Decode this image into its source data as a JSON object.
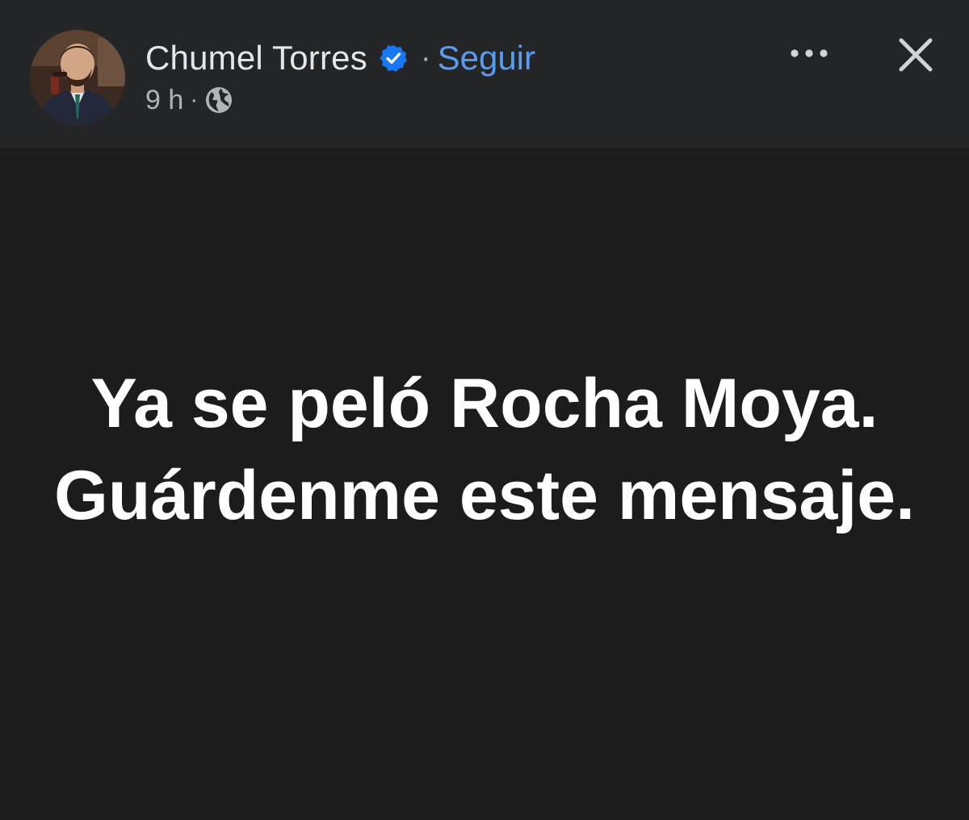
{
  "post": {
    "author": {
      "name": "Chumel Torres",
      "verified_icon": "verified-badge-icon",
      "avatar_icon": "avatar-photo"
    },
    "separator": "·",
    "follow_label": "Seguir",
    "timestamp": "9 h",
    "meta_separator": "·",
    "audience_icon": "globe-icon",
    "actions": {
      "more_icon": "more-options-icon",
      "close_icon": "close-icon"
    },
    "text": "Ya se peló Rocha Moya. Guárdenme este mensaje."
  },
  "colors": {
    "header_bg": "#242526",
    "body_bg": "#1c1c1c",
    "primary_text": "#e4e6eb",
    "secondary_text": "#b0b3b8",
    "link": "#5a9bf0",
    "verified": "#1877f2",
    "post_text": "#ffffff"
  }
}
